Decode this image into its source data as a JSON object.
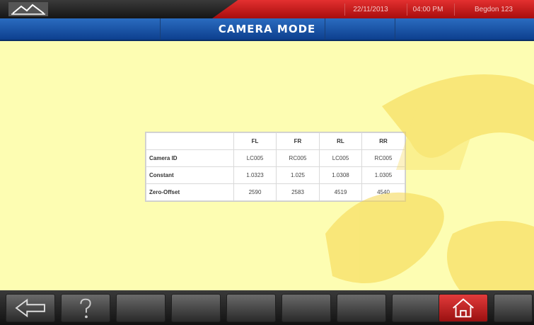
{
  "status": {
    "date": "22/11/2013",
    "time": "04:00 PM",
    "user": "Begdon   123"
  },
  "header": {
    "title": "CAMERA MODE"
  },
  "table": {
    "columns": [
      "",
      "FL",
      "FR",
      "RL",
      "RR"
    ],
    "rows": [
      {
        "label": "Camera ID",
        "values": [
          "LC005",
          "RC005",
          "LC005",
          "RC005"
        ]
      },
      {
        "label": "Constant",
        "values": [
          "1.0323",
          "1.025",
          "1.0308",
          "1.0305"
        ]
      },
      {
        "label": "Zero-Offset",
        "values": [
          "2590",
          "2583",
          "4519",
          "4540"
        ]
      }
    ]
  },
  "toolbar": {
    "buttons": [
      "back-arrow-icon",
      "help-icon",
      "",
      "",
      "",
      "",
      "",
      "",
      "home-icon",
      ""
    ]
  },
  "colors": {
    "background": "#fdfdb2",
    "title_bar": "#1f5cad",
    "accent_red": "#d11f1f",
    "watermark": "#f5d64a"
  }
}
